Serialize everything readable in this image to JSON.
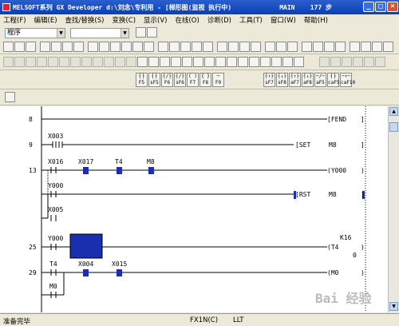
{
  "window": {
    "title": "MELSOFT系列 GX Developer d:\\刘念\\专利用 - [梯形图(监视 执行中)",
    "mode": "MAIN",
    "steps": "177 步",
    "buttons": [
      "_",
      "□",
      "×"
    ]
  },
  "menu": [
    "工程(F)",
    "编辑(E)",
    "查找/替换(S)",
    "变换(C)",
    "显示(V)",
    "在线(O)",
    "诊断(D)",
    "工具(T)",
    "窗口(W)",
    "帮助(H)"
  ],
  "selectors": {
    "project_tree": "程序",
    "device": ""
  },
  "left_marker": "P0",
  "ladder": {
    "steps": [
      "8",
      "9",
      "13",
      "25",
      "29"
    ],
    "contacts": [
      "X003",
      "X016",
      "X017",
      "T4",
      "M8",
      "Y000",
      "X005",
      "Y000",
      "T4",
      "X004",
      "X015",
      "M0"
    ],
    "instructions": [
      "[FEND",
      "[SET",
      "M8",
      "(Y000",
      "[RST",
      "M8",
      "(T4",
      "K16",
      "0",
      "(M0"
    ],
    "brackets": [
      "]",
      "]",
      ")",
      "]",
      ")",
      ")"
    ]
  },
  "function_keys": [
    "F5",
    "sF5",
    "F6",
    "sF6",
    "F7",
    "F8",
    "F9",
    "sF7",
    "sF8",
    "aF7",
    "aF8",
    "aF5",
    "caF5",
    "caF10"
  ],
  "status": {
    "message": "准备完毕",
    "plc": "FX1N(C)",
    "mode": "LLT"
  },
  "watermark": "Bai 经验",
  "colors": {
    "titlebar": "#0a3fb5",
    "monitor_block": "#1a2fb0",
    "contact_on": "#1a2fb0"
  }
}
